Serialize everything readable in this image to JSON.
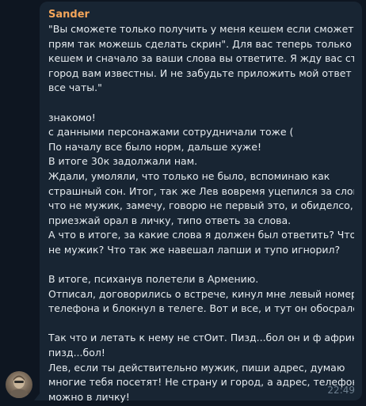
{
  "message": {
    "sender": "Sander",
    "lines": [
      "\"Вы сможете только получить у меня кешем если сможете -",
      "прям так можешь сделать скрин\". Для вас теперь только",
      "кешем и сначало за ваши слова вы ответите. Я жду вас страна",
      "город вам известны. И не забудьте приложить мой ответ во",
      "все чаты.\"",
      "",
      "знакомо!",
      "с данными персонажами сотрудничали тоже (",
      "По началу все было норм, дальше хуже!",
      "В итоге 30к задолжали нам.",
      "Ждали, умоляли, что только не было, вспоминаю как",
      "страшный сон. Итог, так же Лев вовремя уцепился за слова",
      "что не мужик, замечу, говорю не первый это, и обиделсо,",
      "приезжай орал в личку, типо ответь за слова.",
      "А что в итоге, за какие слова я должен был ответить? Что он",
      "не мужик? Что так же навешал лапши и тупо игнорил?",
      "",
      "В итоге, психанув полетели в Армению.",
      "Отписал, договорились о встрече, кинул мне левый номер",
      "телефона и блокнул в телеге. Вот и все, и тут он обосрался.",
      "",
      "Так что и летать к нему не стОит. Пизд...бол он и ф африке",
      "пизд...бол!",
      "Лев, если ты действительно мужик, пиши адрес, думаю",
      "многие тебя посетят! Не страну и город, а адрес, телефон ,",
      "можно в личку!"
    ],
    "time": "22:49"
  },
  "colors": {
    "background": "#0e1621",
    "bubble": "#182533",
    "sender": "#f3a55a",
    "text": "#e6ebef",
    "time": "#6d7f8f"
  }
}
